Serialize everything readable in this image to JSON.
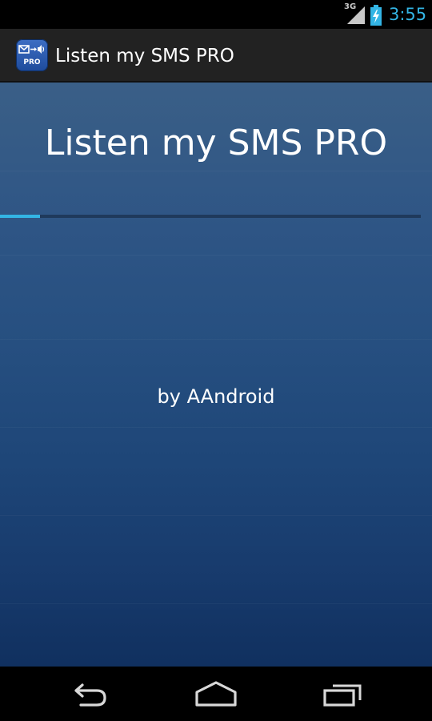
{
  "status_bar": {
    "network_label": "3G",
    "time": "3:55",
    "icons": [
      "signal-icon",
      "battery-charging-icon"
    ]
  },
  "action_bar": {
    "title": "Listen my SMS PRO",
    "app_icon_badge": "PRO",
    "app_icon": "app-icon"
  },
  "main": {
    "title": "Listen my SMS PRO",
    "author": "by AAndroid",
    "progress": 0.095
  },
  "nav_bar": {
    "buttons": [
      "back-icon",
      "home-icon",
      "recent-apps-icon"
    ]
  },
  "colors": {
    "accent": "#33b5e5",
    "action_bar": "#222222",
    "background_top": "#3a5f87",
    "background_bottom": "#10305f"
  }
}
